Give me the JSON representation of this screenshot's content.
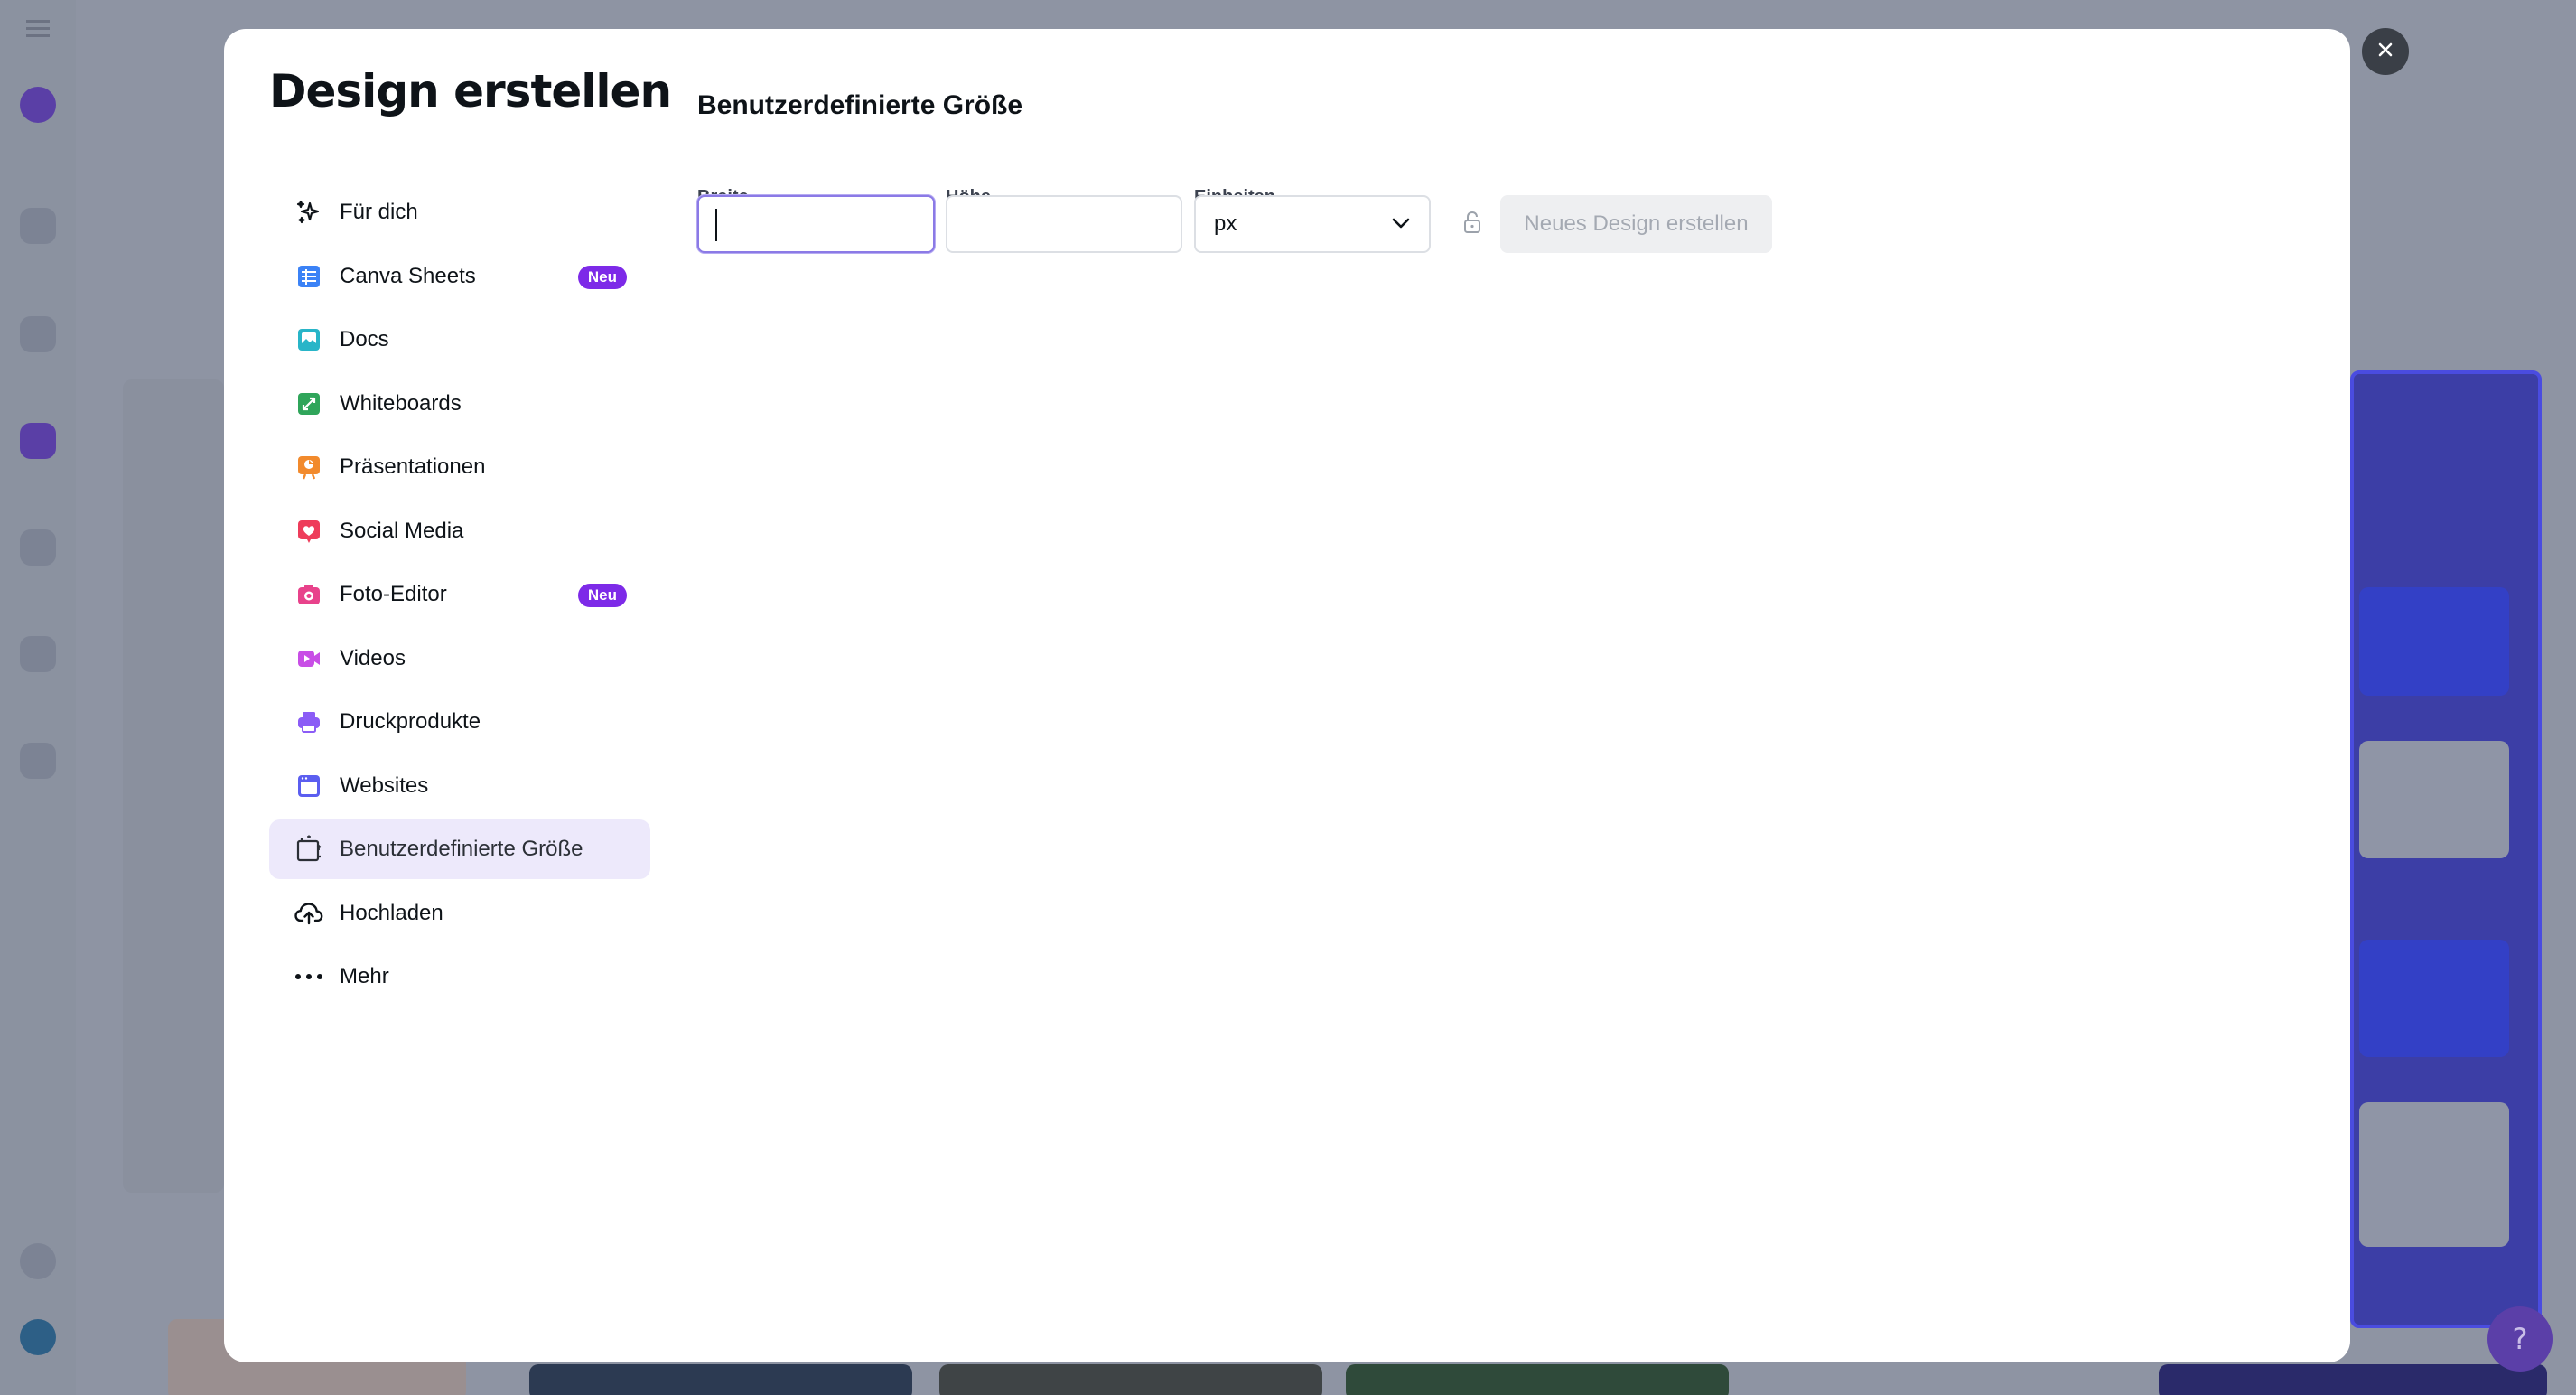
{
  "modal": {
    "title": "Design erstellen",
    "nav": [
      {
        "label": "Für dich",
        "icon": "sparkle-icon",
        "color": "#0e1318"
      },
      {
        "label": "Canva Sheets",
        "icon": "sheets-icon",
        "color": "#3b82f6",
        "badge": "Neu"
      },
      {
        "label": "Docs",
        "icon": "docs-icon",
        "color": "#28b5c8"
      },
      {
        "label": "Whiteboards",
        "icon": "whiteboard-icon",
        "color": "#2fa55a"
      },
      {
        "label": "Präsentationen",
        "icon": "presentation-icon",
        "color": "#f28a2c"
      },
      {
        "label": "Social Media",
        "icon": "heart-icon",
        "color": "#ee3c5a"
      },
      {
        "label": "Foto-Editor",
        "icon": "camera-icon",
        "color": "#e8428b",
        "badge": "Neu"
      },
      {
        "label": "Videos",
        "icon": "video-icon",
        "color": "#c84ee6"
      },
      {
        "label": "Druckprodukte",
        "icon": "printer-icon",
        "color": "#8b5cf6"
      },
      {
        "label": "Websites",
        "icon": "website-icon",
        "color": "#5b5ef0"
      },
      {
        "label": "Benutzerdefinierte Größe",
        "icon": "custom-size-icon",
        "color": "#2b2f36",
        "active": true
      },
      {
        "label": "Hochladen",
        "icon": "cloud-upload-icon",
        "color": "#0e1318"
      },
      {
        "label": "Mehr",
        "icon": "more-dots-icon",
        "color": "#0e1318"
      }
    ],
    "panel": {
      "title": "Benutzerdefinierte Größe",
      "width_label": "Breite",
      "width_value": "",
      "height_label": "Höhe",
      "height_value": "",
      "units_label": "Einheiten",
      "units_value": "px",
      "create_button": "Neues Design erstellen"
    }
  },
  "colors": {
    "accent": "#7d2ae8",
    "active_bg": "#ede9fb",
    "focus_border": "#8b7ae6"
  }
}
